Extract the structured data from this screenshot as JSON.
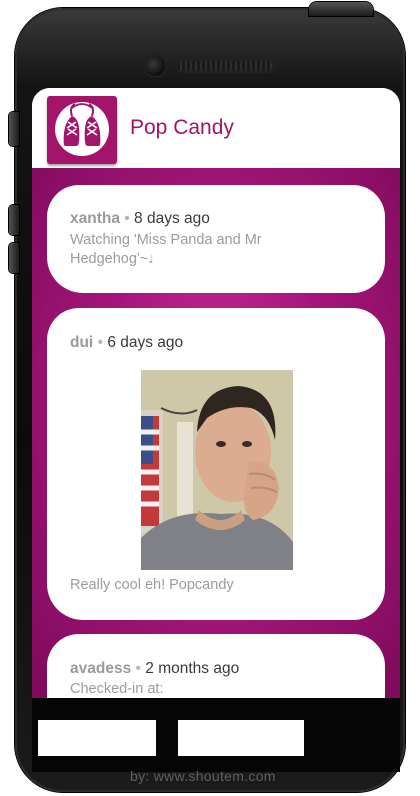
{
  "app": {
    "title": "Pop Candy",
    "icon": "sneakers-icon"
  },
  "colors": {
    "brand": "#a0146a",
    "feed_background": "#a5167a",
    "card": "#ffffff",
    "username": "#9a9a9a"
  },
  "posts": [
    {
      "user": "xantha",
      "separator": "•",
      "time": "8 days ago",
      "text": "Watching 'Miss Panda and Mr Hedgehog'~♩"
    },
    {
      "user": "dui",
      "separator": "•",
      "time": "6 days ago",
      "image": "selfie-photo",
      "caption": "Really cool eh! Popcandy"
    },
    {
      "user": "avadess",
      "separator": "•",
      "time": "2 months ago",
      "text": "Checked-in at:"
    }
  ],
  "footer": {
    "credit": "by: www.shoutem.com"
  }
}
